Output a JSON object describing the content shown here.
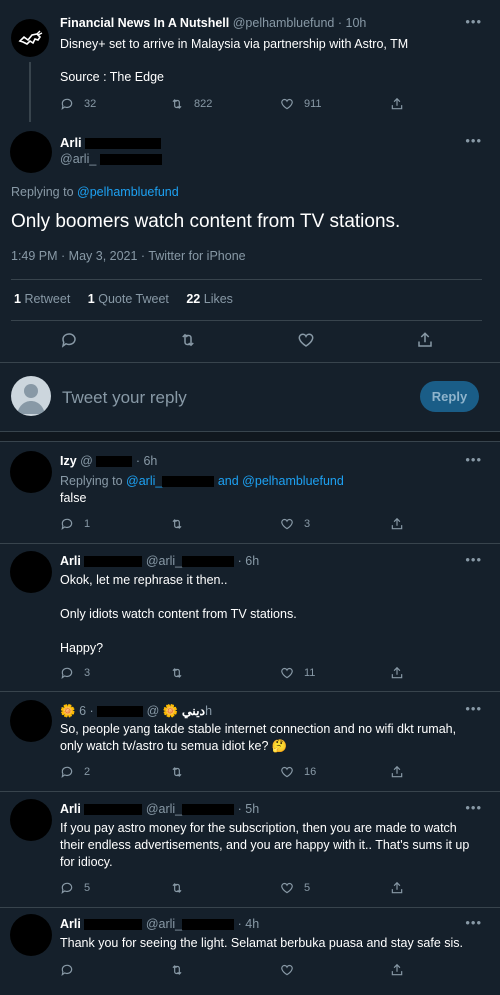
{
  "parent": {
    "name": "Financial News In A Nutshell",
    "handle": "@pelhambluefund",
    "time": "· 10h",
    "text": "Disney+ set to arrive in Malaysia via partnership with Astro, TM",
    "source": "Source : The Edge",
    "reply_count": "32",
    "retweet_count": "822",
    "like_count": "911"
  },
  "main": {
    "name": "Arli",
    "handle": "@arli_",
    "replying_prefix": "Replying to",
    "replying_to": "@pelhambluefund",
    "text": "Only boomers watch content from TV stations.",
    "meta": "1:49 PM · May 3, 2021 · Twitter for iPhone",
    "stats": {
      "retweets_n": "1",
      "retweets_l": "Retweet",
      "quotes_n": "1",
      "quotes_l": "Quote Tweet",
      "likes_n": "22",
      "likes_l": "Likes"
    }
  },
  "composer": {
    "placeholder": "Tweet your reply",
    "button": "Reply"
  },
  "replies": [
    {
      "name": "Izy",
      "handle": "@",
      "time": "· 6h",
      "replying_prefix": "Replying to",
      "replying_a": "@arli_",
      "replying_and": "and",
      "replying_b": "@pelhambluefund",
      "text": "false",
      "reply_count": "1",
      "retweet_count": "",
      "like_count": "3"
    },
    {
      "name": "Arli",
      "handle": "@arli_",
      "time": "· 6h",
      "text": "Okok, let me rephrase it then..\n\nOnly idiots watch content from TV stations.\n\nHappy?",
      "reply_count": "3",
      "retweet_count": "",
      "like_count": "11"
    },
    {
      "name": "ديني",
      "handle": "@",
      "time": "· 6h",
      "text": "So, people yang takde stable internet connection and no wifi dkt rumah, only watch tv/astro tu semua idiot ke? 🤔",
      "reply_count": "2",
      "retweet_count": "",
      "like_count": "16"
    },
    {
      "name": "Arli",
      "handle": "@arli_",
      "time": "· 5h",
      "text": "If you pay astro money for the subscription, then you are made to watch their endless advertisements, and you are happy with it.. That's sums it up for idiocy.",
      "reply_count": "5",
      "retweet_count": "",
      "like_count": "5"
    },
    {
      "name": "Arli",
      "handle": "@arli_",
      "time": "· 4h",
      "text": "Thank you for seeing the light. Selamat berbuka puasa and stay safe sis.",
      "reply_count": "",
      "retweet_count": "",
      "like_count": ""
    }
  ]
}
